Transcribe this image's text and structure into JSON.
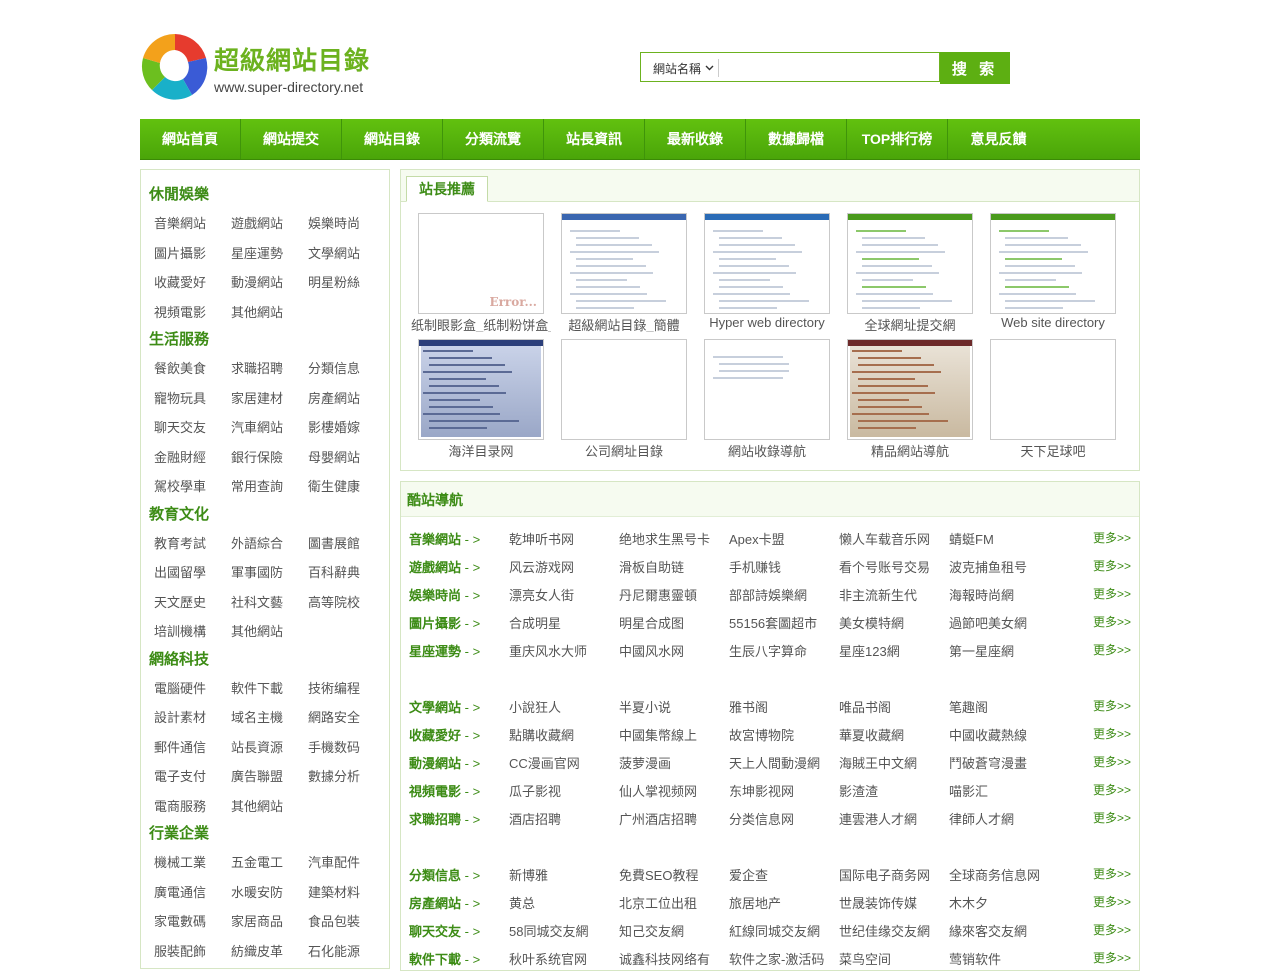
{
  "header": {
    "logo_title": "超級網站目錄",
    "logo_url": "www.super-directory.net",
    "search_select": "網站名稱",
    "search_placeholder": "",
    "search_button": "搜 索"
  },
  "nav": [
    "網站首頁",
    "網站提交",
    "網站目錄",
    "分類流覽",
    "站長資訊",
    "最新收錄",
    "數據歸檔",
    "TOP排行榜",
    "意見反饋"
  ],
  "sidebar": [
    {
      "title": "休閒娛樂",
      "links": [
        "音樂網站",
        "遊戲網站",
        "娛樂時尚",
        "圖片攝影",
        "星座運勢",
        "文學網站",
        "收藏愛好",
        "動漫網站",
        "明星粉絲",
        "視頻電影",
        "其他網站"
      ]
    },
    {
      "title": "生活服務",
      "links": [
        "餐飲美食",
        "求職招聘",
        "分類信息",
        "寵物玩具",
        "家居建材",
        "房產網站",
        "聊天交友",
        "汽車網站",
        "影樓婚嫁",
        "金融財經",
        "銀行保險",
        "母嬰網站",
        "駕校學車",
        "常用查詢",
        "衛生健康"
      ]
    },
    {
      "title": "教育文化",
      "links": [
        "教育考試",
        "外語綜合",
        "圖書展館",
        "出國留學",
        "軍事國防",
        "百科辭典",
        "天文歷史",
        "社科文藝",
        "高等院校",
        "培訓機構",
        "其他網站"
      ]
    },
    {
      "title": "網絡科技",
      "links": [
        "電腦硬件",
        "軟件下載",
        "技術编程",
        "設計素材",
        "域名主機",
        "網路安全",
        "郵件通信",
        "站長資源",
        "手機数码",
        "電子支付",
        "廣告聯盟",
        "數據分析",
        "電商服務",
        "其他網站"
      ]
    },
    {
      "title": "行業企業",
      "links": [
        "機械工業",
        "五金電工",
        "汽車配件",
        "廣電通信",
        "水暖安防",
        "建築材料",
        "家電數碼",
        "家居商品",
        "食品包裝",
        "服裝配飾",
        "紡織皮革",
        "石化能源"
      ]
    }
  ],
  "recommend": {
    "tab": "站長推薦",
    "items": [
      {
        "caption": "纸制眼影盒_纸制粉饼盒_纸制化妆盒_胭鲁",
        "error_text": "Error..."
      },
      {
        "caption": "超級網站目錄_簡體"
      },
      {
        "caption": "Hyper web directory"
      },
      {
        "caption": "全球網址提交網"
      },
      {
        "caption": "Web site directory"
      },
      {
        "caption": "海洋目录网"
      },
      {
        "caption": "公司網址目錄"
      },
      {
        "caption": "網站收錄導航"
      },
      {
        "caption": "精品網站導航"
      },
      {
        "caption": "天下足球吧"
      }
    ]
  },
  "cool": {
    "title": "酷站導航",
    "arrow": " - >",
    "more": "更多>>",
    "groups": [
      [
        {
          "cat": "音樂網站",
          "links": [
            "乾坤听书网",
            "绝地求生黑号卡",
            "Apex卡盟",
            "懒人车载音乐网",
            "蜻蜓FM"
          ]
        },
        {
          "cat": "遊戲網站",
          "links": [
            "风云游戏网",
            "滑板自助链",
            "手机赚钱",
            "看个号账号交易",
            "波克捕鱼租号"
          ]
        },
        {
          "cat": "娛樂時尚",
          "links": [
            "漂亮女人街",
            "丹尼爾惠靈頓",
            "部部詩娛樂網",
            "非主流新生代",
            "海報時尚網"
          ]
        },
        {
          "cat": "圖片攝影",
          "links": [
            "合成明星",
            "明星合成图",
            "55156套圖超市",
            "美女模特網",
            "過節吧美女網"
          ]
        },
        {
          "cat": "星座運勢",
          "links": [
            "重庆风水大师",
            "中國风水网",
            "生辰八字算命",
            "星座123網",
            "第一星座網"
          ]
        }
      ],
      [
        {
          "cat": "文學網站",
          "links": [
            "小說狂人",
            "半夏小说",
            "雅书阁",
            "唯品书阁",
            "笔趣阁"
          ]
        },
        {
          "cat": "收藏愛好",
          "links": [
            "點購收藏網",
            "中國集幣線上",
            "故宮博物院",
            "華夏收藏網",
            "中國收藏熱線"
          ]
        },
        {
          "cat": "動漫網站",
          "links": [
            "CC漫画官网",
            "菠萝漫画",
            "天上人間動漫網",
            "海賊王中文網",
            "鬥破蒼穹漫畫"
          ]
        },
        {
          "cat": "視頻電影",
          "links": [
            "瓜子影视",
            "仙人掌视频网",
            "东坤影视网",
            "影渣渣",
            "喵影汇"
          ]
        },
        {
          "cat": "求職招聘",
          "links": [
            "酒店招聘",
            "广州酒店招聘",
            "分类信息网",
            "連雲港人才網",
            "律師人才網"
          ]
        }
      ],
      [
        {
          "cat": "分類信息",
          "links": [
            "新博雅",
            "免費SEO教程",
            "爱企查",
            "国际电子商务网",
            "全球商务信息网"
          ]
        },
        {
          "cat": "房產網站",
          "links": [
            "黄总",
            "北京工位出租",
            "旅居地产",
            "世晟装饰传媒",
            "木木夕"
          ]
        },
        {
          "cat": "聊天交友",
          "links": [
            "58同城交友網",
            "知己交友網",
            "紅線同城交友網",
            "世纪佳缘交友網",
            "緣來客交友網"
          ]
        },
        {
          "cat": "軟件下載",
          "links": [
            "秋叶系统官网",
            "诚鑫科技网络有",
            "软件之家-激活码",
            "菜鸟空间",
            "莺销软件"
          ]
        }
      ]
    ]
  }
}
